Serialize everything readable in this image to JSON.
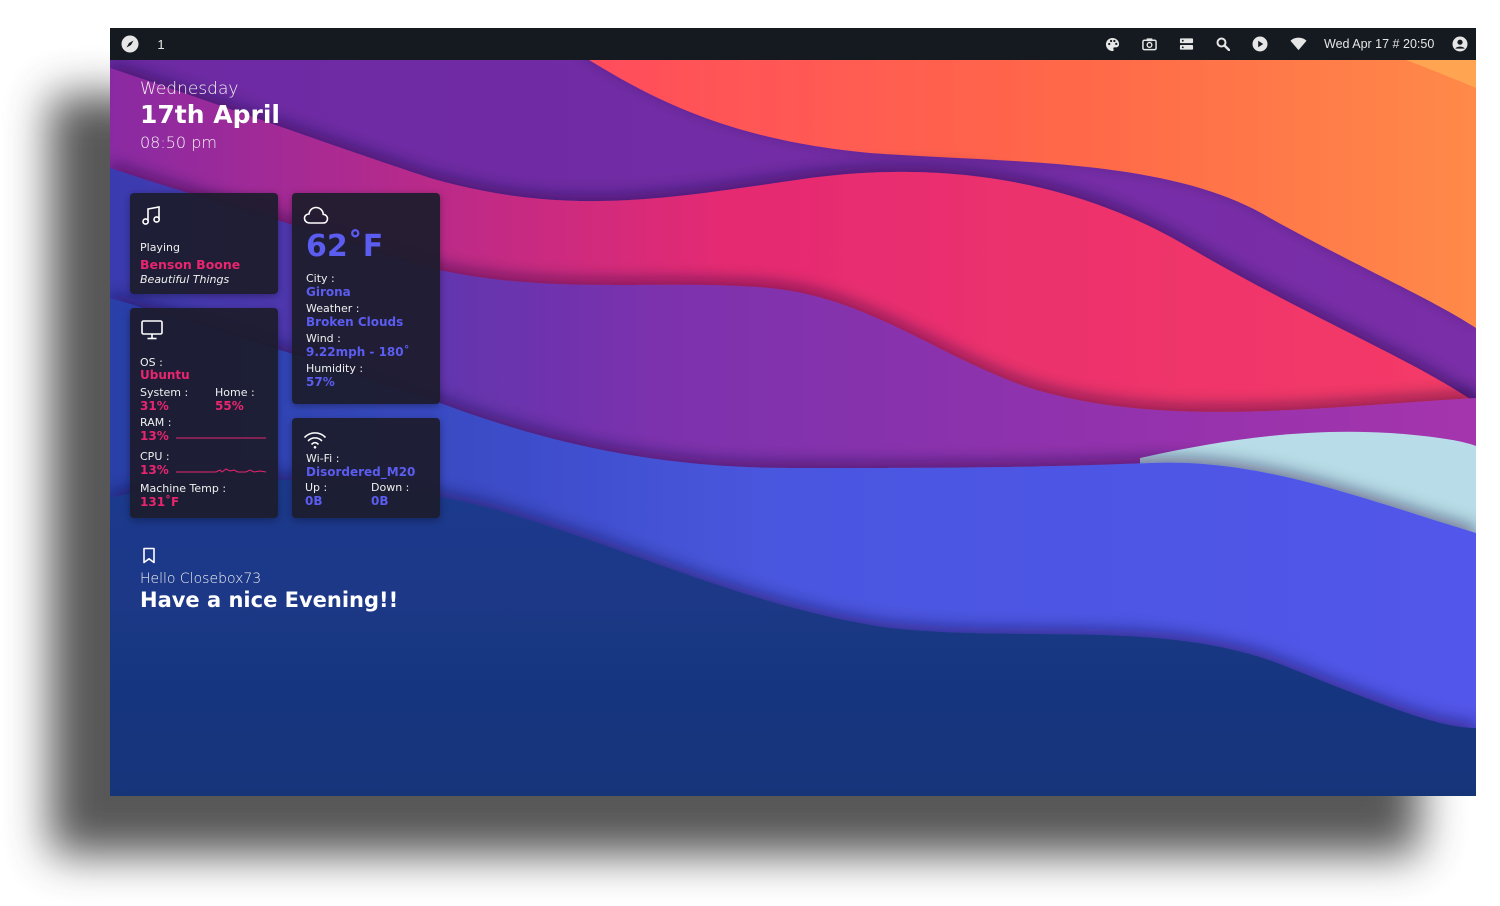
{
  "topbar": {
    "workspace": "1",
    "clock": "Wed Apr 17 # 20:50",
    "icons": [
      "compass-icon",
      "palette-icon",
      "camera-icon",
      "server-icon",
      "search-icon",
      "play-icon",
      "wifi-icon",
      "user-icon"
    ]
  },
  "datetime": {
    "day": "Wednesday",
    "date": "17th April",
    "time": "08:50 pm"
  },
  "music": {
    "icon": "music-note-icon",
    "status": "Playing",
    "artist": "Benson Boone",
    "track": "Beautiful Things"
  },
  "weather": {
    "icon": "cloud-icon",
    "temperature": "62˚F",
    "city_label": "City :",
    "city": "Girona",
    "weather_label": "Weather :",
    "condition": "Broken Clouds",
    "wind_label": "Wind :",
    "wind": "9.22mph - 180˚",
    "humidity_label": "Humidity :",
    "humidity": "57%"
  },
  "system": {
    "icon": "monitor-icon",
    "os_label": "OS :",
    "os": "Ubuntu",
    "system_label": "System :",
    "system_usage": "31%",
    "home_label": "Home :",
    "home_usage": "55%",
    "ram_label": "RAM :",
    "ram": "13%",
    "cpu_label": "CPU :",
    "cpu": "13%",
    "temp_label": "Machine Temp :",
    "temp": "131˚F"
  },
  "network": {
    "icon": "wifi-icon",
    "wifi_label": "Wi-Fi :",
    "ssid": "Disordered_M20",
    "up_label": "Up :",
    "up": "0B",
    "down_label": "Down :",
    "down": "0B"
  },
  "greeting": {
    "icon": "bookmark-icon",
    "hello": "Hello Closebox73",
    "message": "Have a nice Evening!!"
  },
  "colors": {
    "accent_pink": "#e8256e",
    "accent_blue": "#5b5cf0",
    "card_bg": "#1c1c2c",
    "topbar_bg": "#151a20"
  }
}
